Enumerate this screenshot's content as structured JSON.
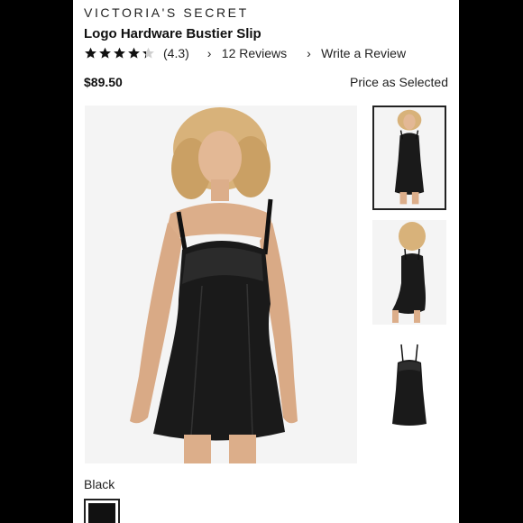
{
  "brand": "VICTORIA'S SECRET",
  "product": {
    "title": "Logo Hardware Bustier Slip",
    "rating_value": "(4.3)",
    "rating_score": 4.3,
    "rating_max": 5,
    "reviews_label": "12 Reviews",
    "write_review_label": "Write a Review",
    "price": "$89.50",
    "price_note": "Price as Selected"
  },
  "color": {
    "label": "Black",
    "swatch_hex": "#111111"
  },
  "icons": {
    "star": "star-icon",
    "chevron": "chevron-right-icon"
  },
  "gallery": {
    "main_alt": "model wearing black satin slip",
    "thumbnails": [
      "front view",
      "back view",
      "product flat"
    ]
  }
}
